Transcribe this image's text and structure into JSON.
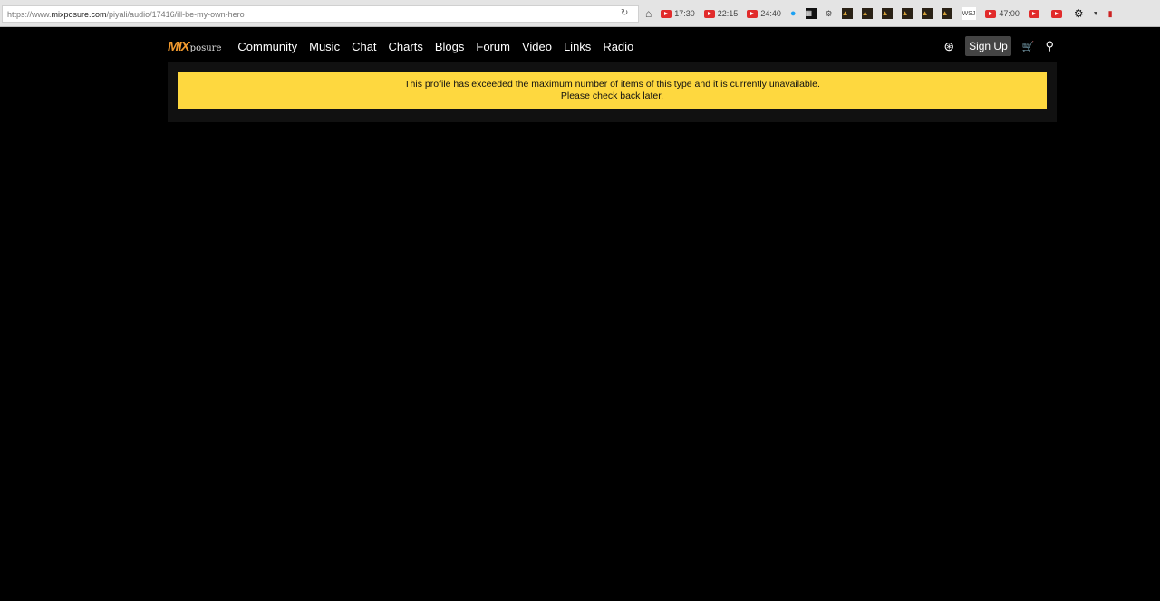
{
  "browser": {
    "url_prefix": "https://www.",
    "url_domain": "mixposure.com",
    "url_path": "/piyali/audio/17416/ill-be-my-own-hero",
    "bookmarks": [
      "17:30",
      "22:15",
      "24:40",
      "47:00"
    ],
    "wsj_label": "WSJ"
  },
  "logo": {
    "mix": "MIX",
    "posure": "posure"
  },
  "nav": {
    "items": [
      "Community",
      "Music",
      "Chat",
      "Charts",
      "Blogs",
      "Forum",
      "Video",
      "Links",
      "Radio"
    ],
    "sign_up": "Sign Up"
  },
  "alert": {
    "line1": "This profile has exceeded the maximum number of items of this type and it is currently unavailable.",
    "line2": "Please check back later."
  },
  "colors": {
    "alert": "#fed83f",
    "logo": "#f29a2e"
  }
}
